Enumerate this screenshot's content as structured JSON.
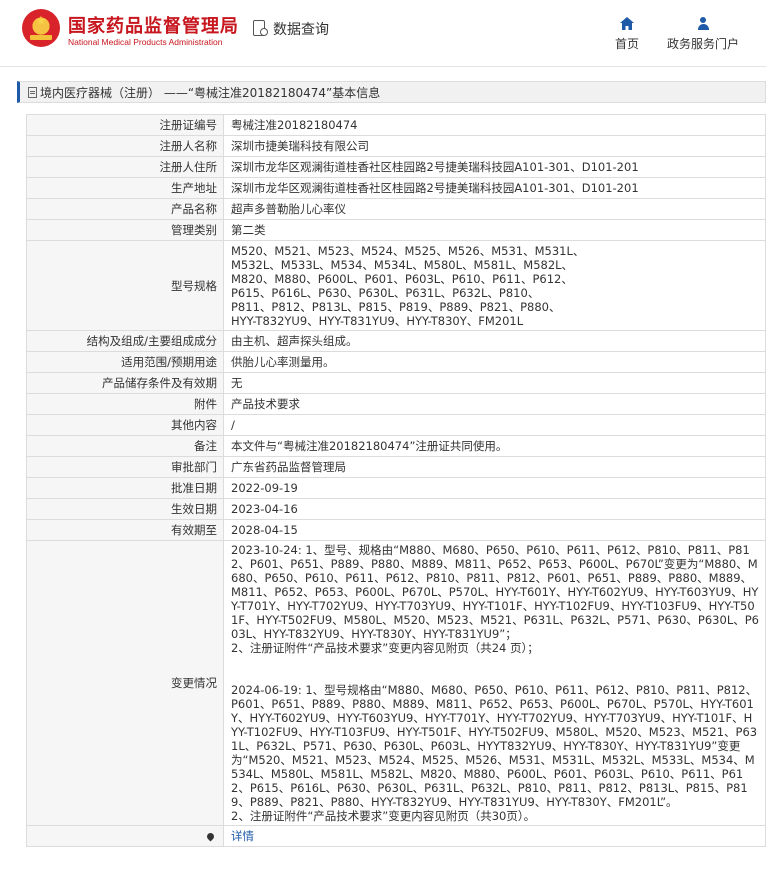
{
  "header": {
    "site_name_cn": "国家药品监督管理局",
    "site_name_en": "National Medical Products Administration",
    "query_label": "数据查询",
    "nav": {
      "home": "首页",
      "gov": "政务服务门户"
    }
  },
  "title": "境内医疗器械（注册） ——“粤械注准20182180474”基本信息",
  "rows": [
    {
      "label": "注册证编号",
      "value": "粤械注准20182180474"
    },
    {
      "label": "注册人名称",
      "value": "深圳市捷美瑞科技有限公司"
    },
    {
      "label": "注册人住所",
      "value": "深圳市龙华区观澜街道桂香社区桂园路2号捷美瑞科技园A101-301、D101-201"
    },
    {
      "label": "生产地址",
      "value": "深圳市龙华区观澜街道桂香社区桂园路2号捷美瑞科技园A101-301、D101-201"
    },
    {
      "label": "产品名称",
      "value": "超声多普勒胎儿心率仪"
    },
    {
      "label": "管理类别",
      "value": "第二类"
    },
    {
      "label": "型号规格",
      "value": "M520、M521、M523、M524、M525、M526、M531、M531L、\nM532L、M533L、M534、M534L、M580L、M581L、M582L、\nM820、M880、P600L、P601、P603L、P610、P611、P612、\nP615、P616L、P630、P630L、P631L、P632L、P810、\nP811、P812、P813L、P815、P819、P889、P821、P880、\nHYY-T832YU9、HYY-T831YU9、HYY-T830Y、FM201L"
    },
    {
      "label": "结构及组成/主要组成成分",
      "value": "由主机、超声探头组成。"
    },
    {
      "label": "适用范围/预期用途",
      "value": "供胎儿心率测量用。"
    },
    {
      "label": "产品储存条件及有效期",
      "value": "无"
    },
    {
      "label": "附件",
      "value": "产品技术要求"
    },
    {
      "label": "其他内容",
      "value": "/"
    },
    {
      "label": "备注",
      "value": "本文件与“粤械注准20182180474”注册证共同使用。"
    },
    {
      "label": "审批部门",
      "value": "广东省药品监督管理局"
    },
    {
      "label": "批准日期",
      "value": "2022-09-19"
    },
    {
      "label": "生效日期",
      "value": "2023-04-16"
    },
    {
      "label": "有效期至",
      "value": "2028-04-15"
    },
    {
      "label": "变更情况",
      "value": "2023-10-24: 1、型号、规格由“M880、M680、P650、P610、P611、P612、P810、P811、P812、P601、P651、P889、P880、M889、M811、P652、P653、P600L、P670L”变更为“M880、M680、P650、P610、P611、P612、P810、P811、P812、P601、P651、P889、P880、M889、M811、P652、P653、P600L、P670L、P570L、HYY-T601Y、HYY-T602YU9、HYY-T603YU9、HYY-T701Y、HYY-T702YU9、HYY-T703YU9、HYY-T101F、HYY-T102FU9、HYY-T103FU9、HYY-T501F、HYY-T502FU9、M580L、M520、M523、M521、P631L、P632L、P571、P630、P630L、P603L、HYY-T832YU9、HYY-T830Y、HYY-T831YU9”；\n2、注册证附件“产品技术要求”变更内容见附页（共24 页）；\n\n\n2024-06-19: 1、型号规格由“M880、M680、P650、P610、P611、P612、P810、P811、P812、P601、P651、P889、P880、M889、M811、P652、P653、P600L、P670L、P570L、HYY-T601Y、HYY-T602YU9、HYY-T603YU9、HYY-T701Y、HYY-T702YU9、HYY-T703YU9、HYY-T101F、HYY-T102FU9、HYY-T103FU9、HYY-T501F、HYY-T502FU9、M580L、M520、M523、M521、P631L、P632L、P571、P630、P630L、P603L、HYYT832YU9、HYY-T830Y、HYY-T831YU9”变更为“M520、M521、M523、M524、M525、M526、M531、M531L、M532L、M533L、M534、M534L、M580L、M581L、M582L、M820、M880、P600L、P601、P603L、P610、P611、P612、P615、P616L、P630、P630L、P631L、P632L、P810、P811、P812、P813L、P815、P819、P889、P821、P880、HYY-T832YU9、HYY-T831YU9、HYY-T830Y、FM201L”。\n2、注册证附件“产品技术要求”变更内容见附页（共30页）。"
    }
  ],
  "detail": {
    "icon": "pin-icon",
    "label": "",
    "link": "详情"
  }
}
